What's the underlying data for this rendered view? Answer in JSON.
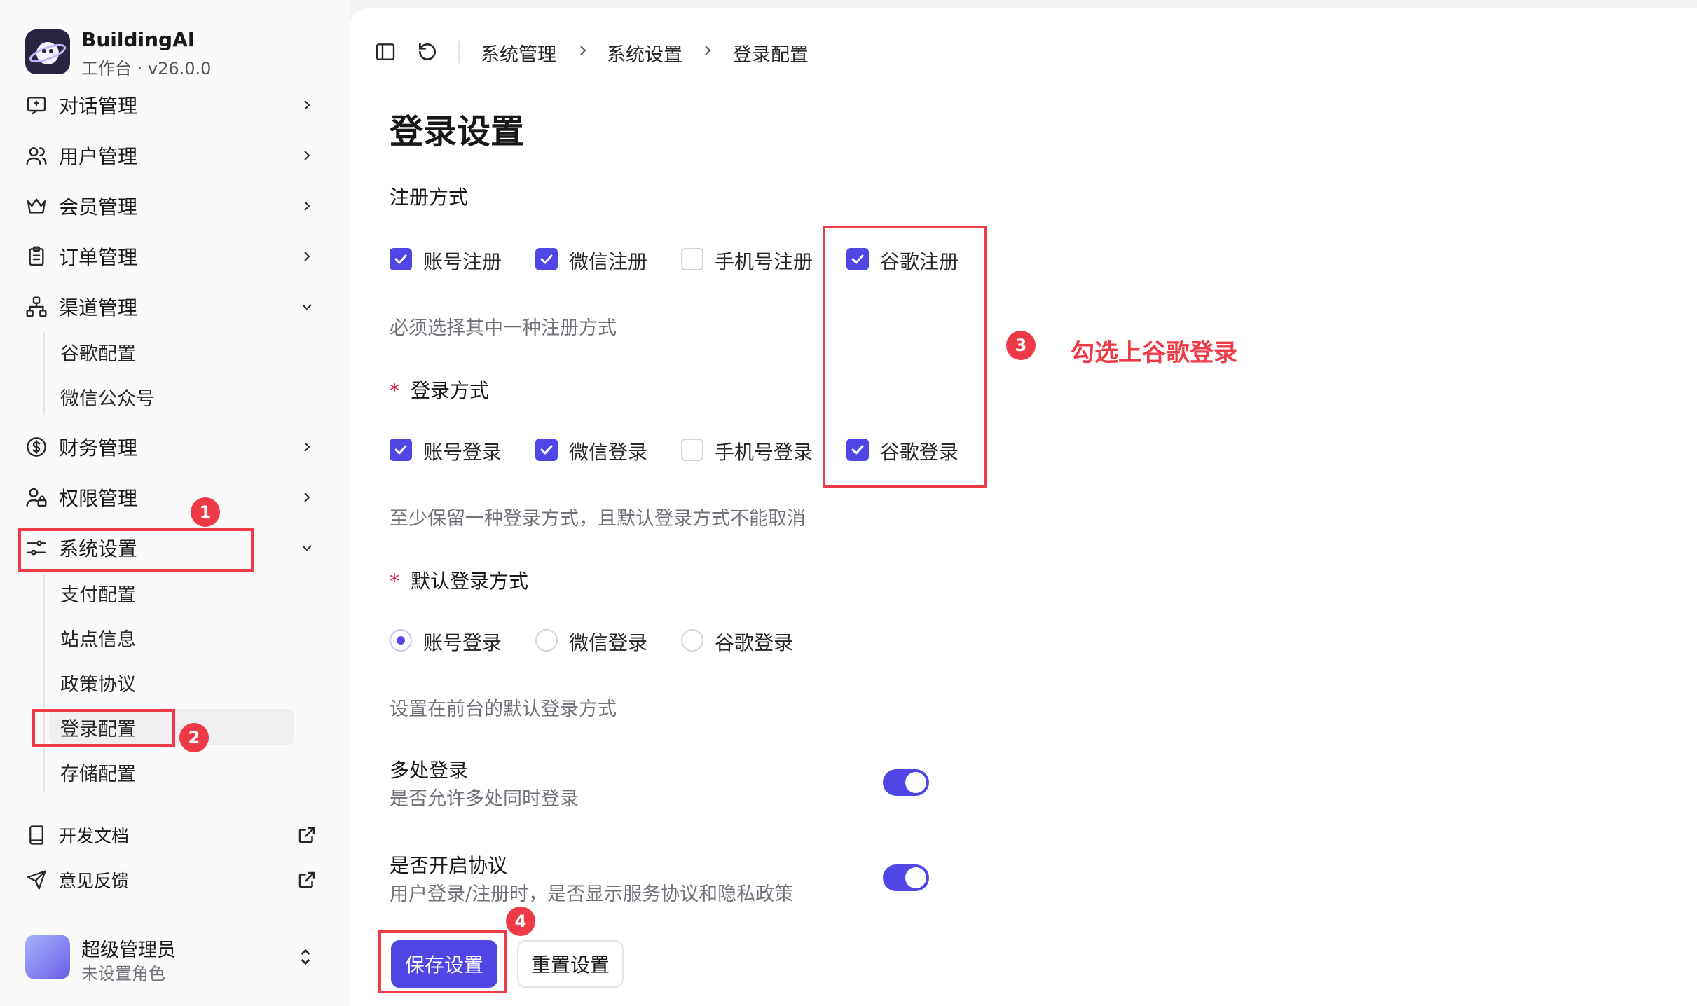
{
  "brand": {
    "name": "BuildingAI",
    "subtitle": "工作台 · v26.0.0"
  },
  "sidebar": {
    "items": [
      {
        "label": "对话管理",
        "icon": "chat-icon"
      },
      {
        "label": "用户管理",
        "icon": "users-icon"
      },
      {
        "label": "会员管理",
        "icon": "crown-icon"
      },
      {
        "label": "订单管理",
        "icon": "clipboard-icon"
      },
      {
        "label": "渠道管理",
        "icon": "network-icon",
        "expanded": true,
        "children": [
          "谷歌配置",
          "微信公众号"
        ]
      },
      {
        "label": "财务管理",
        "icon": "dollar-icon"
      },
      {
        "label": "权限管理",
        "icon": "user-lock-icon"
      },
      {
        "label": "系统设置",
        "icon": "settings-sliders-icon",
        "expanded": true,
        "children": [
          "支付配置",
          "站点信息",
          "政策协议",
          "登录配置",
          "存储配置"
        ],
        "active_child": "登录配置"
      }
    ],
    "links": [
      {
        "label": "开发文档",
        "icon": "book-icon"
      },
      {
        "label": "意见反馈",
        "icon": "send-icon"
      }
    ],
    "user": {
      "name": "超级管理员",
      "role": "未设置角色"
    }
  },
  "breadcrumb": [
    "系统管理",
    "系统设置",
    "登录配置"
  ],
  "page": {
    "title": "登录设置",
    "register": {
      "label": "注册方式",
      "options": [
        {
          "label": "账号注册",
          "checked": true
        },
        {
          "label": "微信注册",
          "checked": true
        },
        {
          "label": "手机号注册",
          "checked": false
        },
        {
          "label": "谷歌注册",
          "checked": true
        }
      ],
      "hint": "必须选择其中一种注册方式"
    },
    "login": {
      "label": "登录方式",
      "required_mark": "*",
      "options": [
        {
          "label": "账号登录",
          "checked": true
        },
        {
          "label": "微信登录",
          "checked": true
        },
        {
          "label": "手机号登录",
          "checked": false
        },
        {
          "label": "谷歌登录",
          "checked": true
        }
      ],
      "hint": "至少保留一种登录方式，且默认登录方式不能取消"
    },
    "default_login": {
      "label": "默认登录方式",
      "required_mark": "*",
      "options": [
        {
          "label": "账号登录",
          "selected": true
        },
        {
          "label": "微信登录",
          "selected": false
        },
        {
          "label": "谷歌登录",
          "selected": false
        }
      ],
      "hint": "设置在前台的默认登录方式"
    },
    "multi_login": {
      "label": "多处登录",
      "desc": "是否允许多处同时登录",
      "enabled": true
    },
    "agreement": {
      "label": "是否开启协议",
      "desc": "用户登录/注册时，是否显示服务协议和隐私政策",
      "enabled": true
    },
    "buttons": {
      "save": "保存设置",
      "reset": "重置设置"
    }
  },
  "annotations": {
    "badges": [
      "1",
      "2",
      "3",
      "4"
    ],
    "note": "勾选上谷歌登录"
  },
  "colors": {
    "accent": "#4f46e5",
    "annotation_red": "#ef3b47"
  }
}
